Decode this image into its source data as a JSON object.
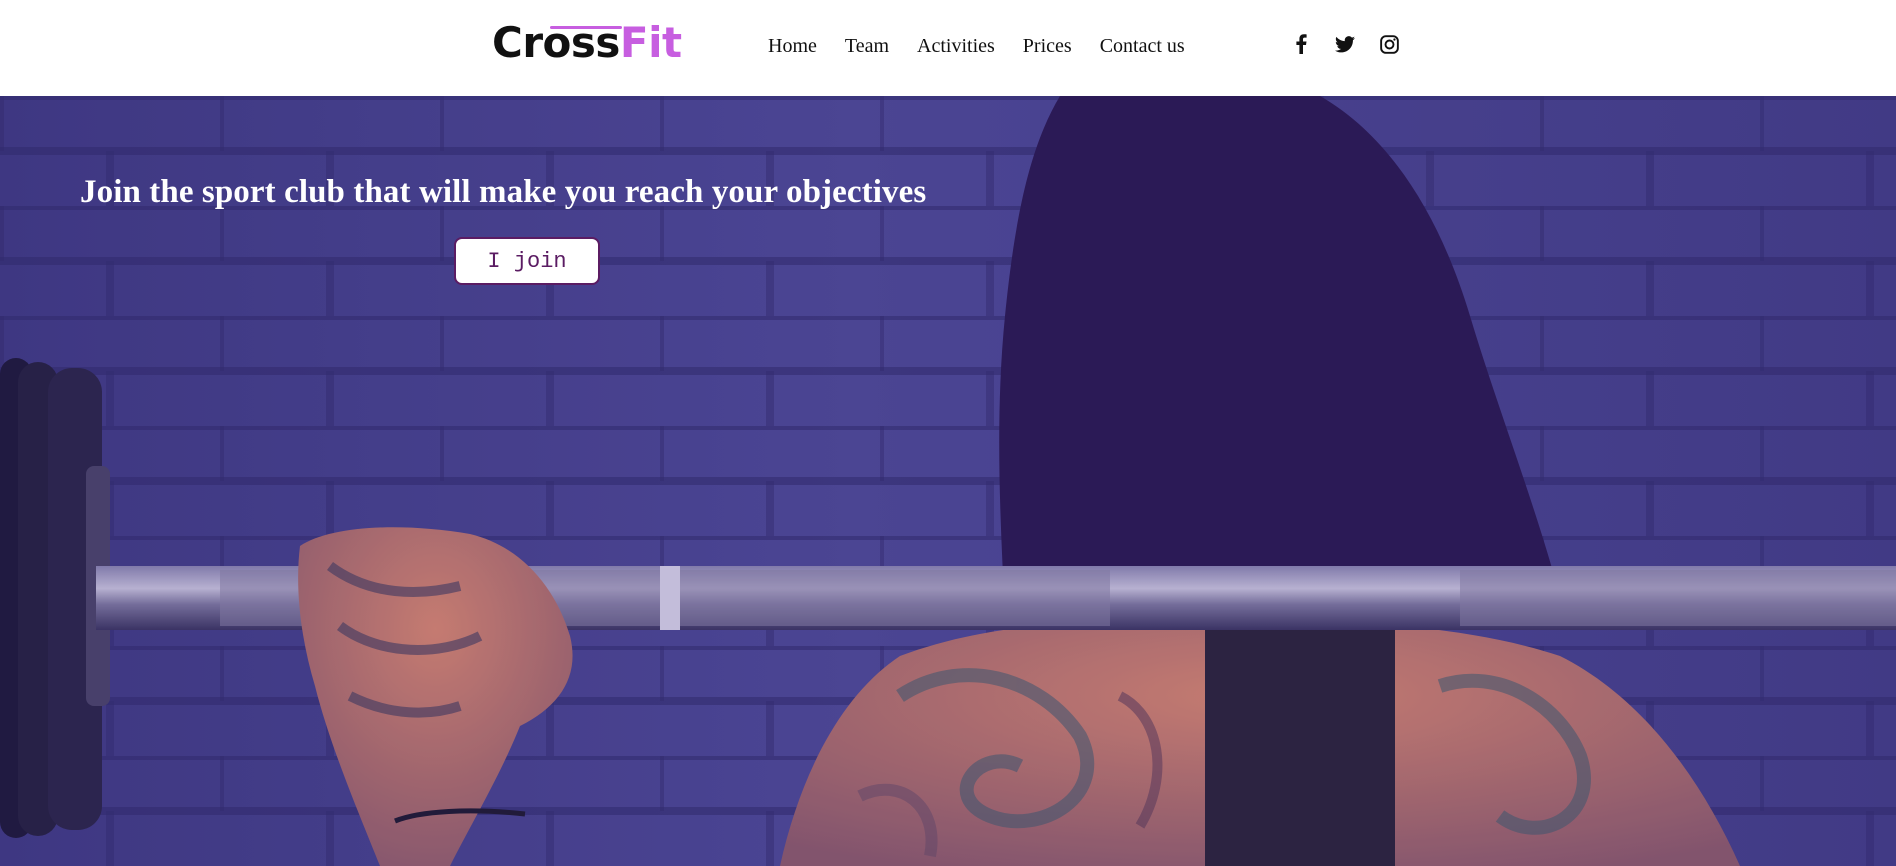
{
  "brand": {
    "name_part_1": "Cross",
    "name_part_2": "Fit",
    "accent_color": "#c75ee0"
  },
  "nav": {
    "items": [
      {
        "label": "Home"
      },
      {
        "label": "Team"
      },
      {
        "label": "Activities"
      },
      {
        "label": "Prices"
      },
      {
        "label": "Contact us"
      }
    ]
  },
  "social": {
    "icons": [
      "facebook-icon",
      "twitter-icon",
      "instagram-icon"
    ]
  },
  "hero": {
    "title": "Join the sport club that will make you reach your objectives",
    "cta_label": "I join",
    "overlay_color": "#4b4690"
  }
}
